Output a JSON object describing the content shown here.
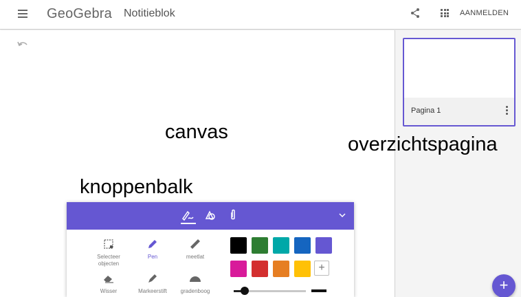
{
  "header": {
    "logo_text": "GeoGebra",
    "title": "Notitieblok",
    "sign_in_label": "AANMELDEN",
    "icons": [
      "menu-icon",
      "share-icon",
      "apps-grid-icon"
    ]
  },
  "canvas": {
    "annotations": {
      "canvas": "canvas",
      "toolbar": "knoppenbalk",
      "pages": "overzichtspagina"
    },
    "icons": [
      "undo-icon"
    ]
  },
  "pages_panel": {
    "pages": [
      {
        "name": "Pagina 1",
        "selected": true
      }
    ],
    "add_page_label": "+"
  },
  "toolbar": {
    "tabs": [
      {
        "name": "pen-tools-tab",
        "icon": "pen-tools-icon",
        "active": true
      },
      {
        "name": "shapes-tab",
        "icon": "shapes-icon",
        "active": false
      },
      {
        "name": "attach-tab",
        "icon": "paperclip-icon",
        "active": false
      }
    ],
    "tools": [
      {
        "label_line1": "Selecteer",
        "label_line2": "objecten",
        "icon": "select-objects-icon",
        "active": false
      },
      {
        "label_line1": "Pen",
        "label_line2": "",
        "icon": "pen-icon",
        "active": true
      },
      {
        "label_line1": "meetlat",
        "label_line2": "",
        "icon": "ruler-icon",
        "active": false
      },
      {
        "label_line1": "Wisser",
        "label_line2": "",
        "icon": "eraser-icon",
        "active": false
      },
      {
        "label_line1": "Markeerstift",
        "label_line2": "",
        "icon": "highlighter-icon",
        "active": false
      },
      {
        "label_line1": "gradenboog",
        "label_line2": "",
        "icon": "protractor-icon",
        "active": false
      }
    ],
    "colors": [
      "#000000",
      "#2e7d32",
      "#00a8a8",
      "#1565c0",
      "#6557d2",
      "#d81b9a",
      "#d32f2f",
      "#e67e22",
      "#ffc107"
    ],
    "selected_color": "#000000",
    "add_color_label": "+",
    "stroke_width_fraction": 0.15,
    "accent": "#6557d2"
  }
}
